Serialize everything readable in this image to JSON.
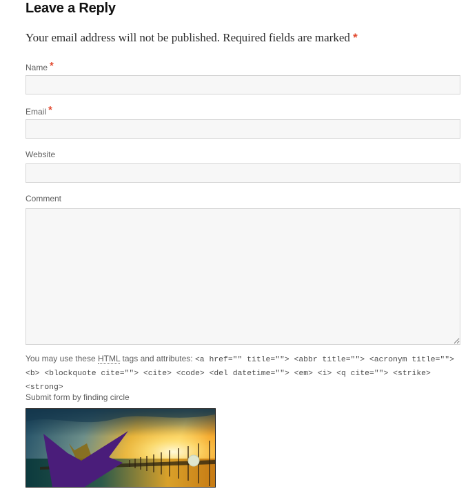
{
  "reply": {
    "title": "Leave a Reply",
    "notes_text": "Your email address will not be published. Required fields are marked",
    "required_marker": "*"
  },
  "form": {
    "name_label": "Name",
    "email_label": "Email",
    "website_label": "Website",
    "comment_label": "Comment",
    "name_value": "",
    "email_value": "",
    "website_value": "",
    "comment_value": ""
  },
  "allowed_tags": {
    "prefix": "You may use these",
    "abbr": "HTML",
    "middle": "tags and attributes:",
    "code": "<a href=\"\" title=\"\"> <abbr title=\"\"> <acronym title=\"\"> <b> <blockquote cite=\"\"> <cite> <code> <del datetime=\"\"> <em> <i> <q cite=\"\"> <strike> <strong>"
  },
  "captcha": {
    "label": "Submit form by finding circle",
    "image_name": "sunset-pier-captcha-image"
  },
  "colors": {
    "required": "#e2492f",
    "field_bg": "#f7f7f7",
    "field_border": "#d4d4d4",
    "label": "#5e5e5e"
  }
}
